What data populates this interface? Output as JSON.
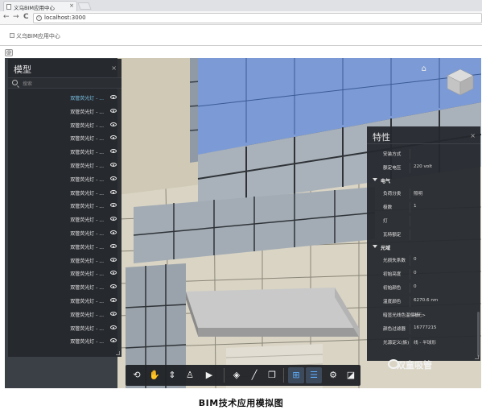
{
  "browser": {
    "tab_title": "义乌BIM应用中心",
    "tab_close": "×",
    "url": "localhost:3000",
    "back": "←",
    "forward": "→",
    "reload": "C"
  },
  "page": {
    "broken_image_alt": "义乌BIM应用中心",
    "small_button": "@"
  },
  "viewer": {
    "home_icon": "home-icon",
    "viewcube_label": "view-cube"
  },
  "model_panel": {
    "title": "模型",
    "close": "×",
    "search_placeholder": "搜索",
    "items": [
      "双管荧光灯 - ...",
      "双管荧光灯 - ...",
      "双管荧光灯 - ...",
      "双管荧光灯 - ...",
      "双管荧光灯 - ...",
      "双管荧光灯 - ...",
      "双管荧光灯 - ...",
      "双管荧光灯 - ...",
      "双管荧光灯 - ...",
      "双管荧光灯 - ...",
      "双管荧光灯 - ...",
      "双管荧光灯 - ...",
      "双管荧光灯 - ...",
      "双管荧光灯 - ...",
      "双管荧光灯 - ...",
      "双管荧光灯 - ...",
      "双管荧光灯 - ...",
      "双管荧光灯 - ...",
      "双管荧光灯 - ..."
    ]
  },
  "props_panel": {
    "title": "特性",
    "close": "×",
    "rows": [
      {
        "type": "prop",
        "key": "安装方式",
        "value": ""
      },
      {
        "type": "prop",
        "key": "额定电压",
        "value": "220 volt"
      },
      {
        "type": "cat",
        "label": "电气"
      },
      {
        "type": "prop",
        "key": "负荷分类",
        "value": "照明"
      },
      {
        "type": "prop",
        "key": "极数",
        "value": "1"
      },
      {
        "type": "prop",
        "key": "灯",
        "value": ""
      },
      {
        "type": "prop",
        "key": "瓦特额定",
        "value": ""
      },
      {
        "type": "cat",
        "label": "光域"
      },
      {
        "type": "prop",
        "key": "光损失系数",
        "value": "0"
      },
      {
        "type": "prop",
        "key": "初始亮度",
        "value": "0"
      },
      {
        "type": "prop",
        "key": "初始颜色",
        "value": "0"
      },
      {
        "type": "prop",
        "key": "温度颜色",
        "value": "6270.6 nm"
      },
      {
        "type": "prop",
        "key": "暗显光线色温偏移",
        "value": "<无>"
      },
      {
        "type": "prop",
        "key": "颜色过滤器",
        "value": "16777215"
      },
      {
        "type": "prop",
        "key": "光源定义(族)",
        "value": "线 - 半球形"
      }
    ]
  },
  "toolbar": {
    "buttons": [
      {
        "name": "orbit-button",
        "glyph": "⟲",
        "active": false
      },
      {
        "name": "pan-button",
        "glyph": "✋",
        "active": false
      },
      {
        "name": "dolly-button",
        "glyph": "⇕",
        "active": false
      },
      {
        "name": "first-person-button",
        "glyph": "♙",
        "active": false
      },
      {
        "name": "camera-button",
        "glyph": "▶",
        "active": false
      },
      {
        "name": "section-button",
        "glyph": "◈",
        "active": false
      },
      {
        "name": "measure-button",
        "glyph": "╱",
        "active": false
      },
      {
        "name": "explode-button",
        "glyph": "❒",
        "active": false
      },
      {
        "name": "model-browser-button",
        "glyph": "⊞",
        "active": true
      },
      {
        "name": "properties-button",
        "glyph": "☰",
        "active": true
      },
      {
        "name": "settings-button",
        "glyph": "⚙",
        "active": false
      },
      {
        "name": "fullscreen-button",
        "glyph": "◪",
        "active": false
      }
    ]
  },
  "watermark": "双童吸管",
  "caption": "BIM技术应用模拟图"
}
